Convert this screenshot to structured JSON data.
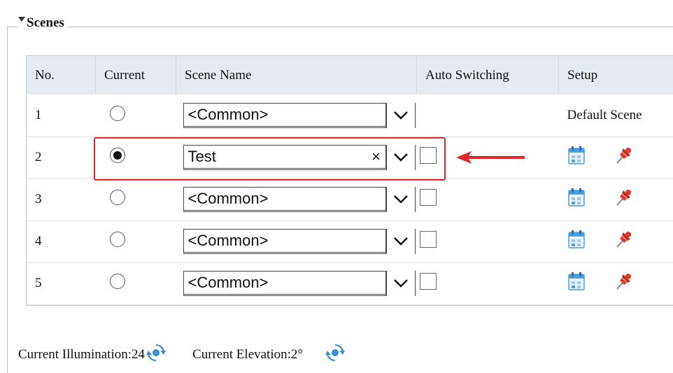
{
  "section": {
    "title": "Scenes"
  },
  "table": {
    "headers": [
      "No.",
      "Current",
      "Scene Name",
      "Auto Switching",
      "Setup"
    ],
    "rows": [
      {
        "no": "1",
        "current": false,
        "scene_name": "<Common>",
        "has_clear": false,
        "auto_switch_visible": false,
        "setup_text": "Default Scene"
      },
      {
        "no": "2",
        "current": true,
        "scene_name": "Test",
        "has_clear": true,
        "auto_switch_visible": true,
        "setup_text": ""
      },
      {
        "no": "3",
        "current": false,
        "scene_name": "<Common>",
        "has_clear": false,
        "auto_switch_visible": true,
        "setup_text": ""
      },
      {
        "no": "4",
        "current": false,
        "scene_name": "<Common>",
        "has_clear": false,
        "auto_switch_visible": true,
        "setup_text": ""
      },
      {
        "no": "5",
        "current": false,
        "scene_name": "<Common>",
        "has_clear": false,
        "auto_switch_visible": true,
        "setup_text": ""
      }
    ],
    "clear_glyph": "×"
  },
  "status": {
    "illumination_label": "Current Illumination:24",
    "elevation_label": "Current Elevation:2°"
  },
  "colors": {
    "header_bg": "#e5ebf1",
    "highlight": "#e3242b",
    "refresh_icon": "#3b8fd6",
    "pin_icon": "#e03a2e",
    "calendar_icon": "#4a9fe0"
  }
}
